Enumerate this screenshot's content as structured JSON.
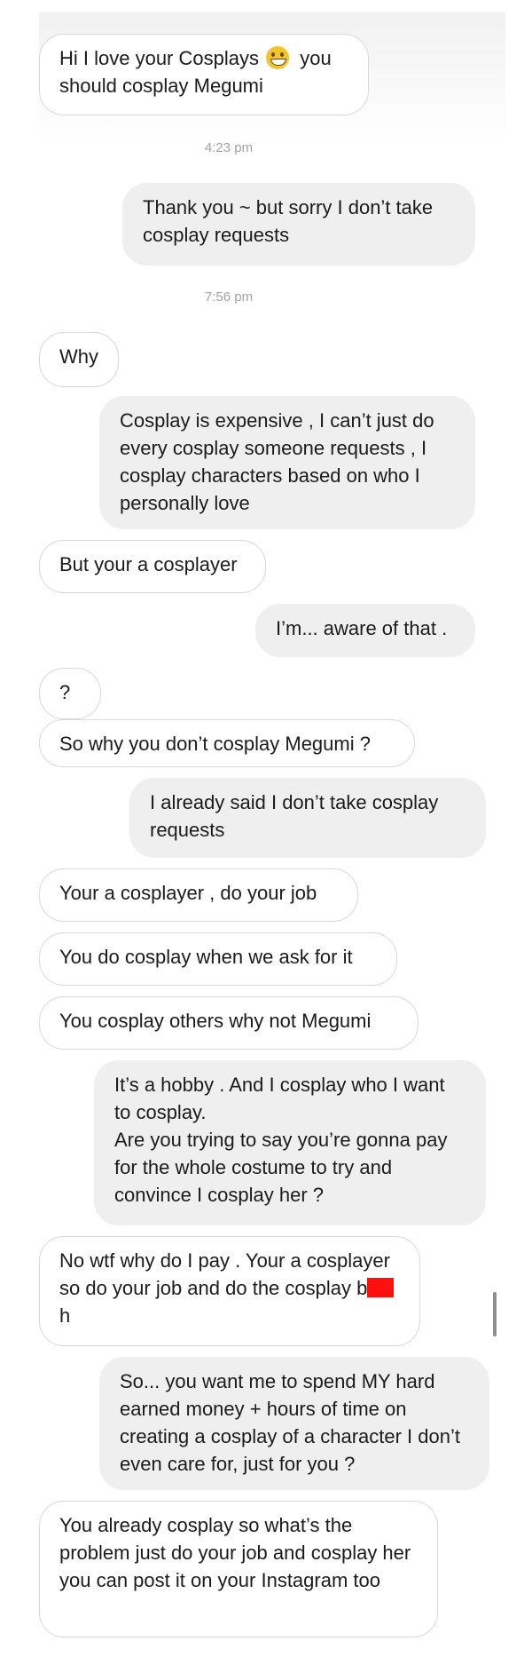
{
  "colors": {
    "outgoing_bubble": "#efefef",
    "incoming_bubble": "#ffffff",
    "incoming_border": "#d8d8d8",
    "timestamp": "#a2a2a2",
    "redaction": "#ff1010"
  },
  "messages": [
    {
      "side": "incoming",
      "text_before_emoji": "Hi I love your Cosplays ",
      "emoji": "grinning-face-emoji",
      "text_after_emoji": " you should cosplay Megumi"
    },
    {
      "side": "timestamp",
      "text": "4:23 pm"
    },
    {
      "side": "outgoing",
      "text": "Thank you ~ but sorry I don’t take cosplay requests"
    },
    {
      "side": "timestamp",
      "text": "7:56 pm"
    },
    {
      "side": "incoming",
      "text": "Why"
    },
    {
      "side": "outgoing",
      "text": "Cosplay is expensive , I can’t just do every cosplay someone requests , I cosplay characters based on who I personally love"
    },
    {
      "side": "incoming",
      "text": "But your a cosplayer"
    },
    {
      "side": "outgoing",
      "text": "I’m... aware of that ."
    },
    {
      "side": "incoming",
      "text": "?"
    },
    {
      "side": "incoming",
      "text": "So why you don’t cosplay Megumi ?"
    },
    {
      "side": "outgoing",
      "text": "I already said I don’t take cosplay requests"
    },
    {
      "side": "incoming",
      "text": "Your a cosplayer , do your job"
    },
    {
      "side": "incoming",
      "text": "You do cosplay when we ask for it"
    },
    {
      "side": "incoming",
      "text": "You cosplay others why not Megumi"
    },
    {
      "side": "outgoing",
      "text": "It’s a hobby . And I cosplay who I want to cosplay.\nAre you trying to say you’re gonna pay for the whole costume to try and convince I cosplay her ?"
    },
    {
      "side": "incoming",
      "text_before_redaction": "No wtf why do I pay . Your a cosplayer so do your job and do the cosplay b",
      "text_after_redaction": "h"
    },
    {
      "side": "outgoing",
      "text": "So... you want me to spend MY hard earned money + hours of time on creating a cosplay of a character I don’t even care for,  just for you ?"
    },
    {
      "side": "incoming",
      "text": "You already cosplay so what’s the problem just do your job and cosplay her you can post it on your Instagram too"
    }
  ]
}
